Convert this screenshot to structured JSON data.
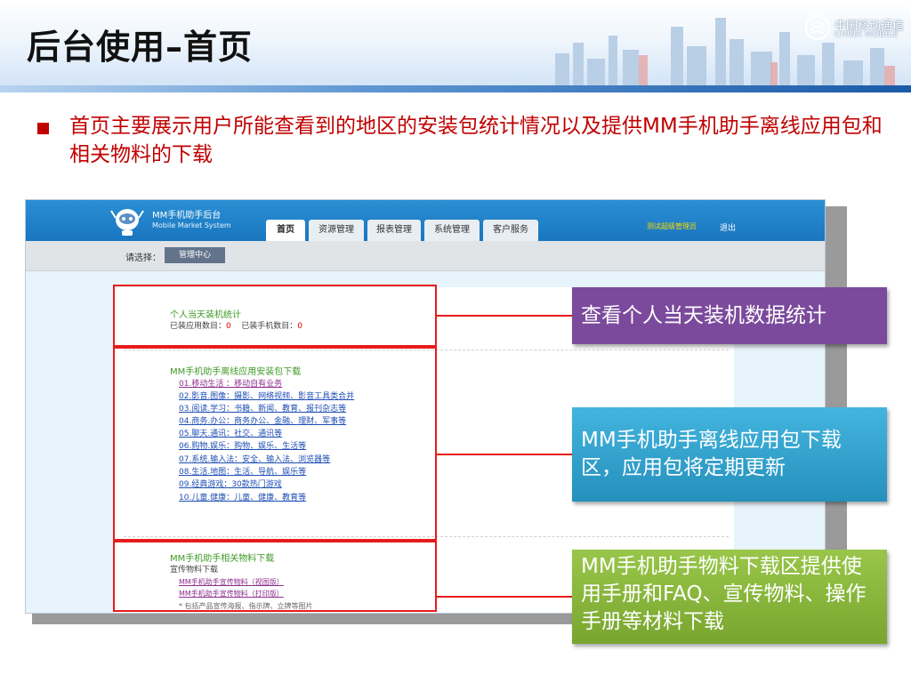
{
  "slide": {
    "title": "后台使用–首页",
    "logo_cn": "中国移动通信",
    "logo_en": "CHINA MOBILE",
    "bullet": "首页主要展示用户所能查看到的地区的安装包统计情况以及提供MM手机助手离线应用包和相关物料的下载"
  },
  "app": {
    "name": "MM手机助手后台",
    "subtitle": "Mobile Market System",
    "tabs": [
      {
        "label": "首页",
        "active": true
      },
      {
        "label": "资源管理",
        "active": false
      },
      {
        "label": "报表管理",
        "active": false
      },
      {
        "label": "系统管理",
        "active": false
      },
      {
        "label": "客户服务",
        "active": false
      }
    ],
    "admin_user": "测试超级管理员",
    "logout": "退出",
    "select_label": "请选择：",
    "select_button": "管理中心",
    "stats": {
      "title": "个人当天装机统计",
      "apps_label": "已装应用数目：",
      "apps_value": "0",
      "phones_label": "已装手机数目：",
      "phones_value": "0"
    },
    "offline": {
      "title": "MM手机助手离线应用安装包下载",
      "links": [
        "01.移动生活 ：移动自有业务",
        "02.影音.图像：摄影、网络视频、影音工具类合并",
        "03.阅读.学习：书籍、新闻、教育、报刊杂志等",
        "04.商务.办公：商务办公、金融、理财、军事等",
        "05.聊天.通讯：社交、通讯等",
        "06.购物.娱乐：购物、娱乐、生活等",
        "07.系统.输入法：安全、输入法、浏览器等",
        "08.生活.地图：生活、导航、娱乐等",
        "09.经典游戏：30款热门游戏",
        "10.儿童.健康：儿童、健康、教育等"
      ]
    },
    "materials": {
      "title": "MM手机助手相关物料下载",
      "subtitle": "宣传物料下载",
      "links": [
        "MM手机助手宣传物料（视图版）",
        "MM手机助手宣传物料（打印版）"
      ],
      "note": "* 包括产品宣传海报、指示牌、立牌等图片"
    }
  },
  "callouts": {
    "stats": "查看个人当天装机数据统计",
    "offline": "MM手机助手离线应用包下载区，应用包将定期更新",
    "materials": "MM手机助手物料下载区提供使用手册和FAQ、宣传物料、操作手册等材料下载"
  },
  "colors": {
    "accent_red": "#c00000",
    "highlight_red": "#e81b1b",
    "callout_stats": "#7b4a9c",
    "callout_offline": "#2f9cc4",
    "callout_materials": "#86b13a",
    "app_header_blue": "#1a76bf"
  }
}
